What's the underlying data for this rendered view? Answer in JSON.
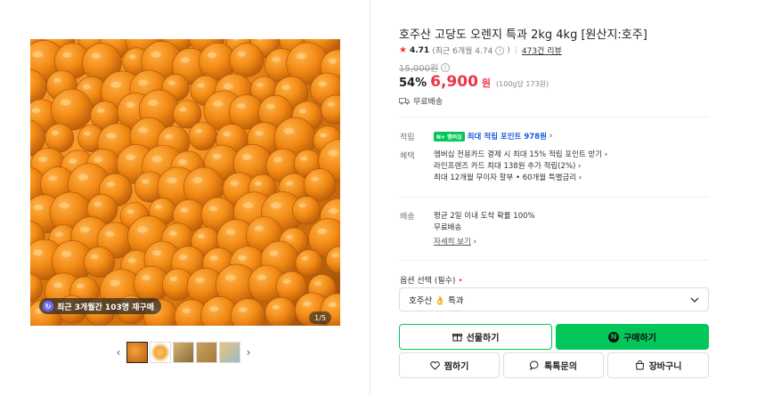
{
  "gallery": {
    "rebuy_badge": "최근 3개월간 103명 재구매",
    "counter": "1/5",
    "prev_icon": "chevron-left-icon",
    "next_icon": "chevron-right-icon",
    "thumbnail_count": 5
  },
  "product": {
    "title": "호주산 고당도 오렌지 특과 2kg 4kg [원산지:호주]",
    "rating": "4.71",
    "rating_detail": "(최근 6개월 4.74",
    "reviews": "473건 리뷰",
    "original_price": "15,000원",
    "discount": "54%",
    "price": "6,900",
    "price_unit": "원",
    "unit_price": "(100g당 173원)",
    "shipping": "무료배송"
  },
  "benefits": {
    "points_label": "적립",
    "npay_badge": "N+ 멤버십",
    "points_text": "최대 적립 포인트 978원",
    "benefit_label": "혜택",
    "benefit_lines": [
      "멤버십 전용카드 결제 시 최대 15% 적립 포인트 받기",
      "라인프렌즈 카드 최대 138원 추가 적립(2%)",
      "최대 12개월 무이자 할부 • 60개월 특별금리"
    ]
  },
  "delivery": {
    "label": "배송",
    "line1": "평균 2일 이내 도착 확률 100%",
    "line2": "무료배송",
    "more": "자세히 보기"
  },
  "option": {
    "label": "옵션 선택 (필수)",
    "required_mark": "•",
    "selected": "호주산 👌 특과"
  },
  "buttons": {
    "gift": "선물하기",
    "buy": "구매하기",
    "wish": "찜하기",
    "talk": "톡톡문의",
    "cart": "장바구니"
  },
  "colors": {
    "accent": "#03c75a",
    "price": "#f0334a",
    "points": "#1a5be0"
  }
}
